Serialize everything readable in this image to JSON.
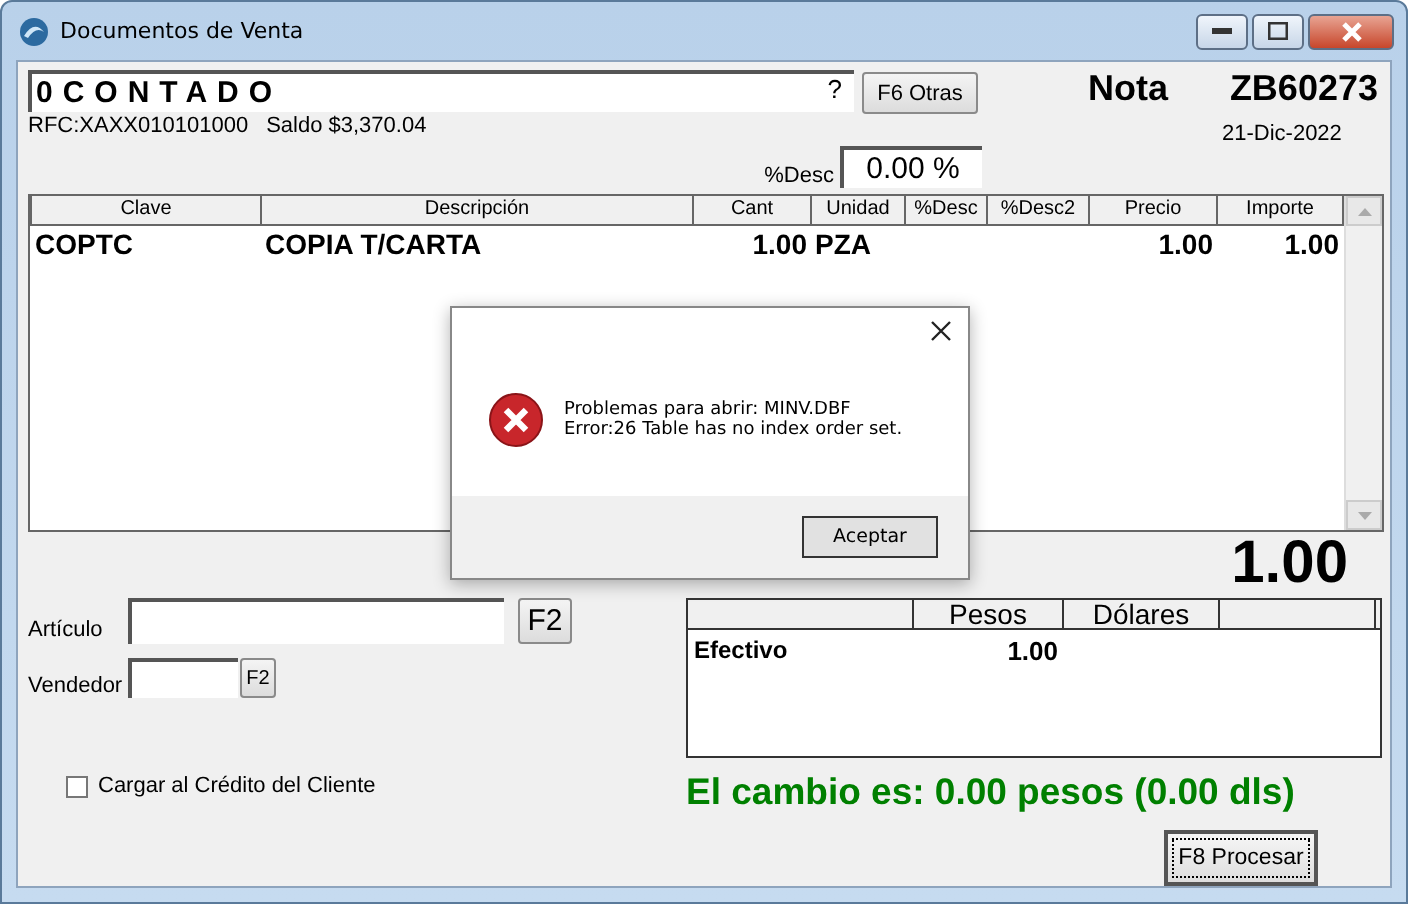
{
  "window": {
    "title": "Documentos de Venta"
  },
  "customer": {
    "value": "0CONTADO",
    "help": "?",
    "other_button": "F6 Otras",
    "rfc": "RFC:XAXX010101000",
    "saldo": "Saldo $3,370.04"
  },
  "document": {
    "type": "Nota",
    "number": "ZB60273",
    "date": "21-Dic-2022"
  },
  "discount": {
    "label": "%Desc",
    "value": "0.00 %"
  },
  "items_table": {
    "columns": [
      "Clave",
      "Descripción",
      "Cant",
      "Unidad",
      "%Desc",
      "%Desc2",
      "Precio",
      "Importe"
    ],
    "rows": [
      {
        "clave": "COPTC",
        "descripcion": "COPIA T/CARTA",
        "cant": "1.00",
        "unidad": "PZA",
        "precio": "1.00",
        "importe": "1.00"
      }
    ]
  },
  "total": "1.00",
  "articulo": {
    "label": "Artículo",
    "button": "F2"
  },
  "vendedor": {
    "label": "Vendedor",
    "button": "F2"
  },
  "credit_checkbox": {
    "label": "Cargar al Crédito del Cliente",
    "checked": false
  },
  "payments": {
    "columns": [
      "Pesos",
      "Dólares"
    ],
    "rows": [
      {
        "method": "Efectivo",
        "pesos": "1.00"
      }
    ]
  },
  "change_text": "El cambio es: 0.00 pesos (0.00 dls)",
  "process_button": "F8 Procesar",
  "dialog": {
    "message_lines": [
      "Problemas para abrir: MINV.DBF",
      "Error:26 Table has no index order set."
    ],
    "button": "Aceptar"
  }
}
